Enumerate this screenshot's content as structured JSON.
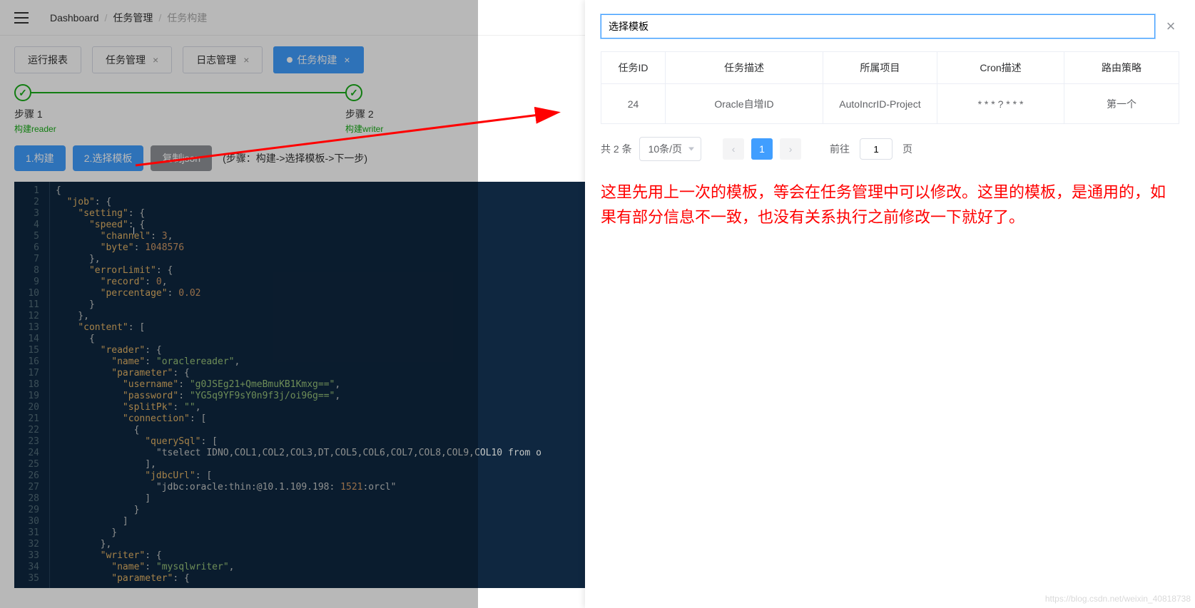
{
  "header": {
    "breadcrumb": [
      "Dashboard",
      "任务管理",
      "任务构建"
    ]
  },
  "tabs": [
    {
      "label": "运行报表",
      "closable": false
    },
    {
      "label": "任务管理",
      "closable": true
    },
    {
      "label": "日志管理",
      "closable": true
    },
    {
      "label": "任务构建",
      "closable": true,
      "active": true
    }
  ],
  "steps": {
    "step1": {
      "title": "步骤 1",
      "sub": "构建reader"
    },
    "step2": {
      "title": "步骤 2",
      "sub": "构建writer"
    }
  },
  "buttons": {
    "build": "1.构建",
    "select_template": "2.选择模板",
    "copy_json": "复制json",
    "hint": "(步骤：构建->选择模板->下一步)"
  },
  "code_lines": [
    "{",
    "  \"job\": {",
    "    \"setting\": {",
    "      \"speed\": {",
    "        \"channel\": 3,",
    "        \"byte\": 1048576",
    "      },",
    "      \"errorLimit\": {",
    "        \"record\": 0,",
    "        \"percentage\": 0.02",
    "      }",
    "    },",
    "    \"content\": [",
    "      {",
    "        \"reader\": {",
    "          \"name\": \"oraclereader\",",
    "          \"parameter\": {",
    "            \"username\": \"g0JSEg21+QmeBmuKB1Kmxg==\",",
    "            \"password\": \"YG5q9YF9sY0n9f3j/oi96g==\",",
    "            \"splitPk\": \"\",",
    "            \"connection\": [",
    "              {",
    "                \"querySql\": [",
    "                  \"tselect IDNO,COL1,COL2,COL3,DT,COL5,COL6,COL7,COL8,COL9,COL10 from o",
    "                ],",
    "                \"jdbcUrl\": [",
    "                  \"jdbc:oracle:thin:@10.1.109.198:1521:orcl\"",
    "                ]",
    "              }",
    "            ]",
    "          }",
    "        },",
    "        \"writer\": {",
    "          \"name\": \"mysqlwriter\",",
    "          \"parameter\": {"
  ],
  "drawer": {
    "input_value": "选择模板",
    "table": {
      "headers": [
        "任务ID",
        "任务描述",
        "所属项目",
        "Cron描述",
        "路由策略"
      ],
      "rows": [
        {
          "id": "24",
          "desc": "Oracle自增ID",
          "project": "AutoIncrID-Project",
          "cron": "* * * ? * * *",
          "route": "第一个"
        }
      ]
    },
    "pagination": {
      "total_label": "共 2 条",
      "page_size": "10条/页",
      "current": "1",
      "goto_prefix": "前往",
      "goto_val": "1",
      "goto_suffix": "页"
    },
    "annotation": "这里先用上一次的模板，等会在任务管理中可以修改。这里的模板，是通用的，如果有部分信息不一致，也没有关系执行之前修改一下就好了。"
  },
  "watermark": "https://blog.csdn.net/weixin_40818738"
}
